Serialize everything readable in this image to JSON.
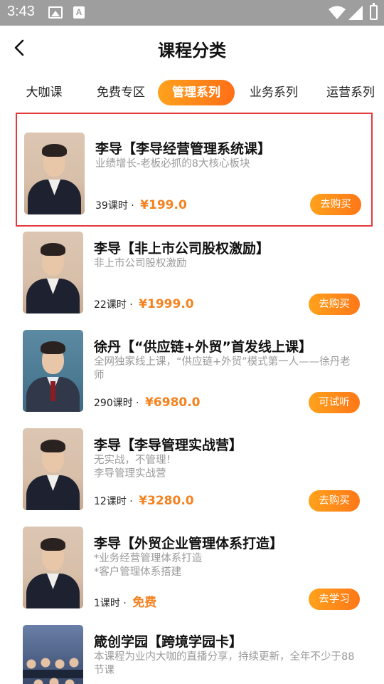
{
  "status_bar": {
    "time": "3:43",
    "icons": [
      "image-icon",
      "a-icon",
      "wifi-icon",
      "signal-icon",
      "battery-icon"
    ]
  },
  "header": {
    "title": "课程分类",
    "back_icon": "chevron-left-icon"
  },
  "tabs": [
    {
      "label": "大咖课",
      "active": false
    },
    {
      "label": "免费专区",
      "active": false
    },
    {
      "label": "管理系列",
      "active": true
    },
    {
      "label": "业务系列",
      "active": false
    },
    {
      "label": "运营系列",
      "active": false
    }
  ],
  "colors": {
    "accent": "#f5821f",
    "button_gradient_start": "#ffa21c",
    "button_gradient_end": "#ff7718",
    "selection_border": "#e4393c",
    "status_bar": "#9e9e9e"
  },
  "courses": [
    {
      "title": "李导【李导经营管理系统课】",
      "desc": "业绩增长-老板必抓的8大核心板块",
      "lessons": "39课时 · ",
      "price": "¥199.0",
      "button": "去购买",
      "selected": true
    },
    {
      "title": "李导【非上市公司股权激励】",
      "desc": "非上市公司股权激励",
      "lessons": "22课时 · ",
      "price": "¥1999.0",
      "button": "去购买",
      "selected": false
    },
    {
      "title": "徐丹【“供应链+外贸”首发线上课】",
      "desc": "全网独家线上课，“供应链+外贸”模式第一人——徐丹老师",
      "lessons": "290课时 · ",
      "price": "¥6980.0",
      "button": "可试听",
      "selected": false
    },
    {
      "title": "李导【李导管理实战营】",
      "desc": "无实战，不管理！\n李导管理实战营",
      "lessons": "12课时 · ",
      "price": "¥3280.0",
      "button": "去购买",
      "selected": false
    },
    {
      "title": "李导【外贸企业管理体系打造】",
      "desc": "*业务经营管理体系打造\n*客户管理体系搭建",
      "lessons": "1课时 · ",
      "price": "免费",
      "button": "去学习",
      "selected": false
    },
    {
      "title": "箴创学园【跨境学园卡】",
      "desc": "本课程为业内大咖的直播分享，持续更新，全年不少于88节课",
      "lessons": "",
      "price": "",
      "button": "",
      "selected": false
    }
  ]
}
